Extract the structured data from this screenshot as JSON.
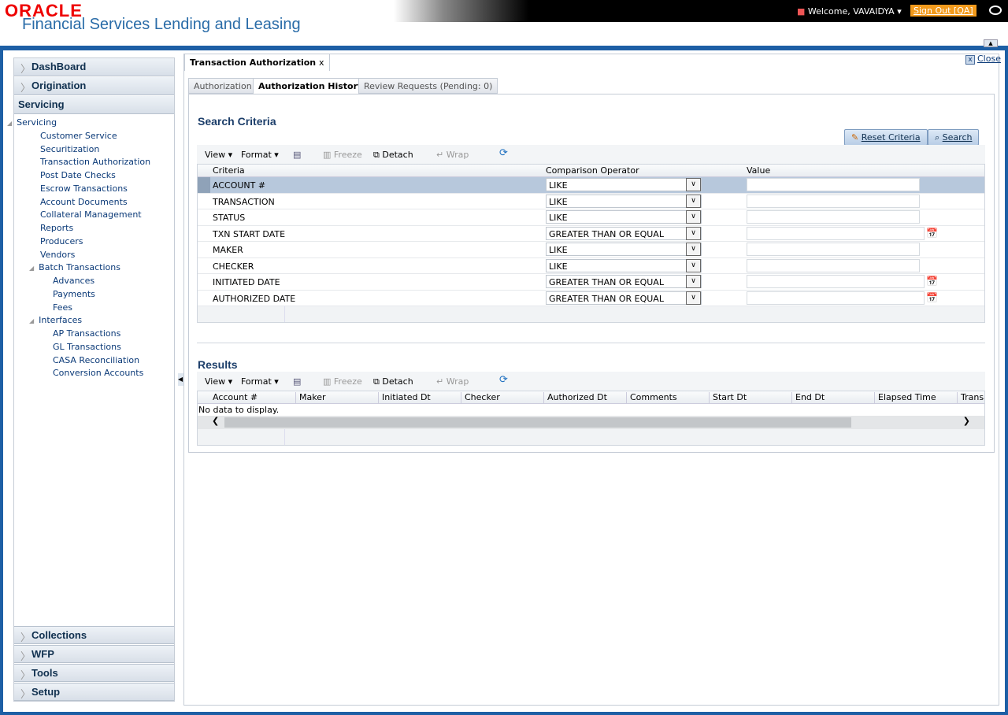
{
  "header": {
    "logo": "ORACLE",
    "product": "Financial Services Lending and Leasing",
    "welcome": "Welcome, VAVAIDYA ▾",
    "sign_out": "Sign Out [QA]"
  },
  "sidebar": {
    "top_sections": [
      "DashBoard",
      "Origination"
    ],
    "active_section": "Servicing",
    "tree": [
      {
        "label": "Servicing",
        "level": 0,
        "expanded": true
      },
      {
        "label": "Customer Service",
        "level": 1
      },
      {
        "label": "Securitization",
        "level": 1
      },
      {
        "label": "Transaction Authorization",
        "level": 1
      },
      {
        "label": "Post Date Checks",
        "level": 1
      },
      {
        "label": "Escrow Transactions",
        "level": 1
      },
      {
        "label": "Account Documents",
        "level": 1
      },
      {
        "label": "Collateral Management",
        "level": 1
      },
      {
        "label": "Reports",
        "level": 1
      },
      {
        "label": "Producers",
        "level": 1
      },
      {
        "label": "Vendors",
        "level": 1
      },
      {
        "label": "Batch Transactions",
        "level": 1,
        "expanded": true
      },
      {
        "label": "Advances",
        "level": 2
      },
      {
        "label": "Payments",
        "level": 2
      },
      {
        "label": "Fees",
        "level": 2
      },
      {
        "label": "Interfaces",
        "level": 1,
        "expanded": true
      },
      {
        "label": "AP Transactions",
        "level": 2
      },
      {
        "label": "GL Transactions",
        "level": 2
      },
      {
        "label": "CASA Reconciliation",
        "level": 2
      },
      {
        "label": "Conversion Accounts",
        "level": 2
      }
    ],
    "bottom_sections": [
      "Collections",
      "WFP",
      "Tools",
      "Setup"
    ]
  },
  "main": {
    "doc_tab": "Transaction Authorization",
    "doc_tab_close": "x",
    "close_label": "Close",
    "tabs": [
      "Authorization",
      "Authorization History",
      "Review Requests (Pending: 0)"
    ],
    "active_tab": 1,
    "search": {
      "title": "Search Criteria",
      "reset": "Reset Criteria",
      "search": "Search",
      "toolbar": {
        "view": "View ▾",
        "format": "Format ▾",
        "freeze": "Freeze",
        "detach": "Detach",
        "wrap": "Wrap"
      },
      "columns": [
        "Criteria",
        "Comparison Operator",
        "Value"
      ],
      "rows": [
        {
          "criteria": "ACCOUNT #",
          "operator": "LIKE",
          "value": "",
          "date": false
        },
        {
          "criteria": "TRANSACTION",
          "operator": "LIKE",
          "value": "",
          "date": false
        },
        {
          "criteria": "STATUS",
          "operator": "LIKE",
          "value": "",
          "date": false
        },
        {
          "criteria": "TXN START DATE",
          "operator": "GREATER THAN OR EQUAL",
          "value": "",
          "date": true
        },
        {
          "criteria": "MAKER",
          "operator": "LIKE",
          "value": "",
          "date": false
        },
        {
          "criteria": "CHECKER",
          "operator": "LIKE",
          "value": "",
          "date": false
        },
        {
          "criteria": "INITIATED DATE",
          "operator": "GREATER THAN OR EQUAL",
          "value": "",
          "date": true
        },
        {
          "criteria": "AUTHORIZED DATE",
          "operator": "GREATER THAN OR EQUAL",
          "value": "",
          "date": true
        }
      ]
    },
    "results": {
      "title": "Results",
      "columns": [
        "Account #",
        "Maker",
        "Initiated Dt",
        "Checker",
        "Authorized Dt",
        "Comments",
        "Start Dt",
        "End Dt",
        "Elapsed Time",
        "Transac"
      ],
      "empty": "No data to display."
    }
  }
}
